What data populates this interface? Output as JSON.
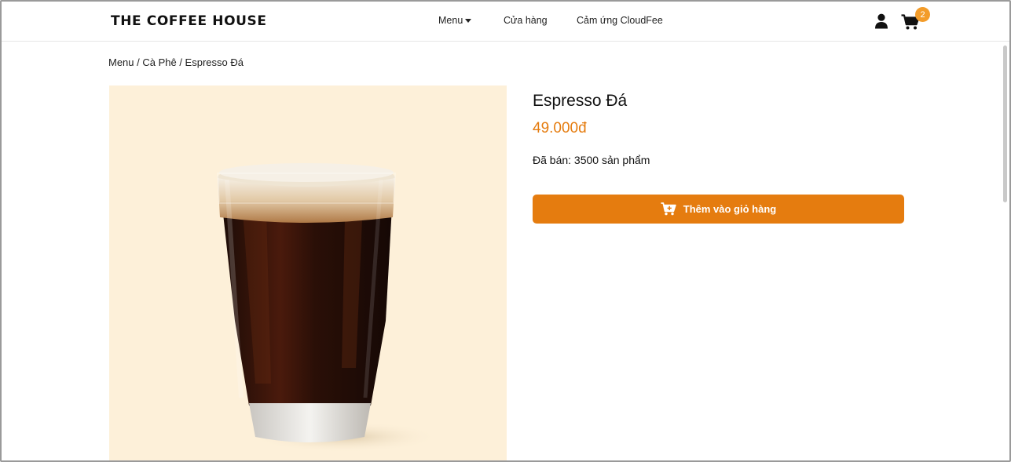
{
  "header": {
    "logo": "THE COFFEE HOUSE",
    "nav": {
      "menu": "Menu",
      "store": "Cửa hàng",
      "cloud": "Cảm ứng CloudFee"
    },
    "cart_count": "2"
  },
  "breadcrumb": "Menu / Cà Phê / Espresso Đá",
  "product": {
    "name": "Espresso Đá",
    "price": "49.000đ",
    "sold": "Đã bán: 3500 sản phẩm",
    "add_to_cart": "Thêm vào giỏ hàng"
  },
  "colors": {
    "accent": "#e57c0f",
    "badge": "#f39c2a",
    "image_bg": "#fdf0d9"
  },
  "icons": {
    "user": "user-icon",
    "cart": "cart-icon",
    "caret": "caret-down-icon"
  }
}
